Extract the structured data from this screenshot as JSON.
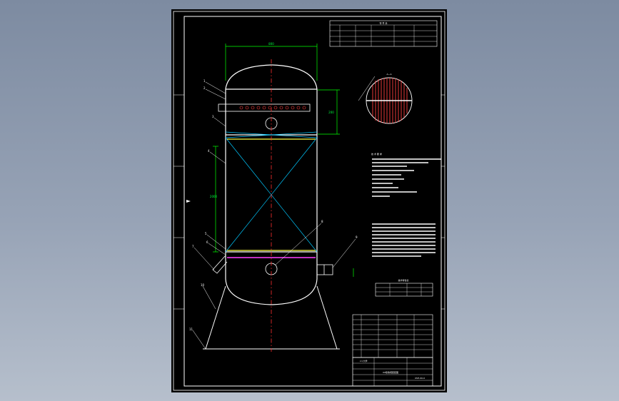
{
  "colors": {
    "background_top": "#7d8ba1",
    "background_bottom": "#b6bfcc",
    "sheet": "#000000",
    "outline": "#ffffff",
    "dimension": "#00ff00",
    "centerline": "#ff3030",
    "diagonal": "#00c8ff",
    "support_plate": "#ffff40",
    "distributor": "#ff40ff",
    "pipe_holes": "#ff4040"
  },
  "icons": {
    "expand_icon": "arrow-right-icon"
  },
  "drawing": {
    "parts_table_header": "零 件 表",
    "section_label": "A—A",
    "notes_title": "技 术 要 求",
    "spec_title": "技术特性表",
    "dimension_labels": {
      "top_width": "800",
      "top_height": "200",
      "middle_height": "2000"
    },
    "callouts": [
      "1",
      "2",
      "3",
      "4",
      "5",
      "6",
      "7",
      "8",
      "9",
      "10",
      "11"
    ],
    "title_block": {
      "company": "××大学",
      "drawing_name": "XX吸收塔装配图",
      "drawing_no": "XSH-00-0"
    }
  }
}
